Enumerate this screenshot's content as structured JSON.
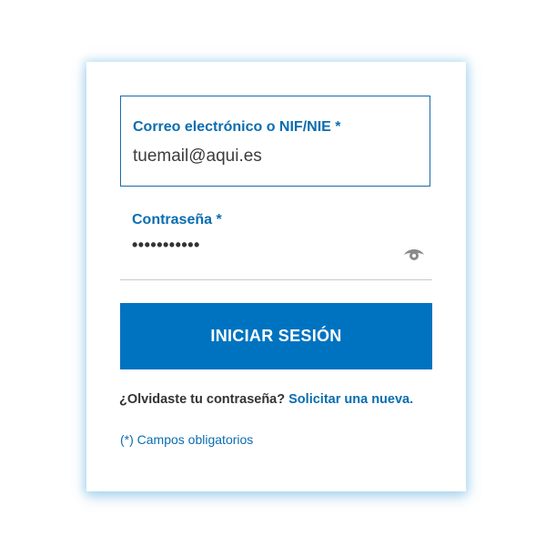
{
  "form": {
    "email": {
      "label": "Correo electrónico o NIF/NIE *",
      "value": "tuemail@aqui.es"
    },
    "password": {
      "label": "Contraseña *",
      "masked_value": "•••••••••••",
      "toggle_icon": "eye-icon"
    },
    "submit_label": "INICIAR SESIÓN",
    "forgot": {
      "text": "¿Olvidaste tu contraseña?",
      "link_text": "Solicitar una nueva."
    },
    "required_note": "(*) Campos obligatorios"
  },
  "colors": {
    "accent": "#0073c0",
    "label": "#0a6db0",
    "text": "#333333",
    "border": "#1a6aa8"
  }
}
